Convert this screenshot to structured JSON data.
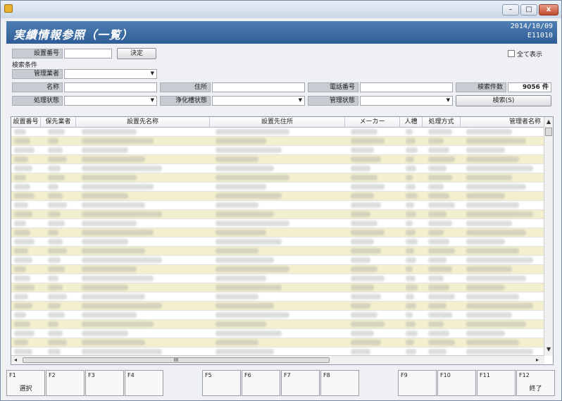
{
  "window": {
    "icon": "app-icon",
    "minimize": "–",
    "maximize": "□",
    "close": "x"
  },
  "header": {
    "title": "実績情報参照（一覧）",
    "date": "2014/10/09",
    "code": "E11010"
  },
  "form": {
    "setchi_label": "設置番号",
    "decide_button": "決定",
    "show_all_label": "全て表示",
    "search_conditions": "検索条件",
    "kanri_label": "管理業者",
    "name_label": "名称",
    "address_label": "住所",
    "phone_label": "電話番号",
    "count_label": "検索件数",
    "count_value": "9056 件",
    "shori_label": "処理状態",
    "jouka_label": "浄化槽状態",
    "kanri_state_label": "管理状態",
    "search_button": "検索(S)"
  },
  "grid": {
    "columns": [
      "設置番号",
      "保先業者",
      "設置先名称",
      "設置先住所",
      "メーカー",
      "人槽",
      "処理方式",
      "管理者名称"
    ],
    "row_count": 25,
    "note": ""
  },
  "scroll": {
    "up": "▲",
    "down": "▼",
    "left": "◂",
    "right": "▸",
    "grip": "III"
  },
  "fkeys": [
    {
      "key": "F1",
      "label": "選択"
    },
    {
      "key": "F2",
      "label": ""
    },
    {
      "key": "F3",
      "label": ""
    },
    {
      "key": "F4",
      "label": ""
    },
    {
      "key": "F5",
      "label": ""
    },
    {
      "key": "F6",
      "label": ""
    },
    {
      "key": "F7",
      "label": ""
    },
    {
      "key": "F8",
      "label": ""
    },
    {
      "key": "F9",
      "label": ""
    },
    {
      "key": "F10",
      "label": ""
    },
    {
      "key": "F11",
      "label": ""
    },
    {
      "key": "F12",
      "label": "終了"
    }
  ]
}
